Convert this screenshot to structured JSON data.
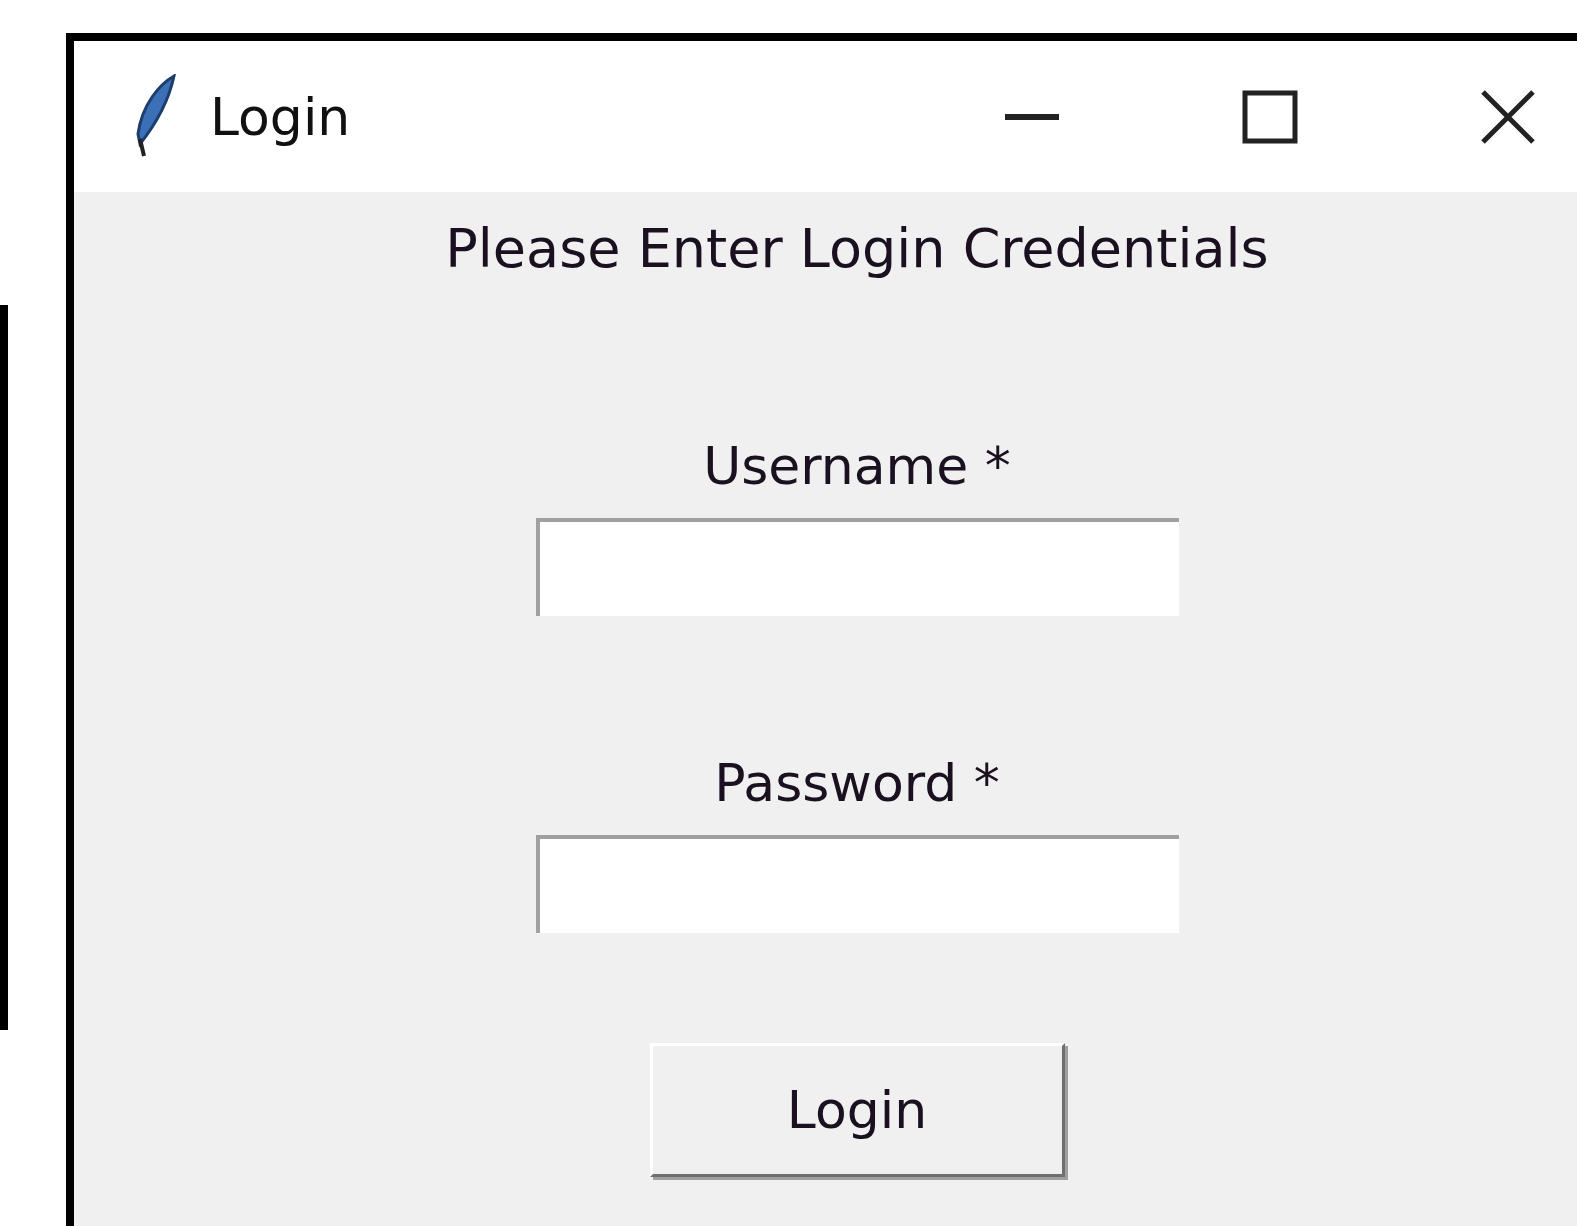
{
  "window": {
    "title": "Login"
  },
  "heading": "Please Enter Login Credentials",
  "fields": [
    {
      "label": "Username *"
    },
    {
      "label": "Password *"
    }
  ],
  "button": {
    "label": "Login"
  }
}
